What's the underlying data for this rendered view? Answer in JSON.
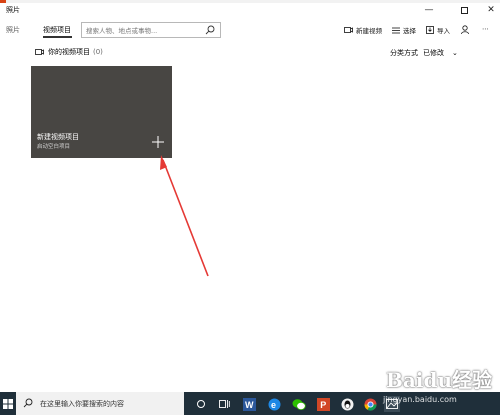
{
  "app": {
    "title": "照片"
  },
  "window_controls": {
    "minimize": "—",
    "close": "✕"
  },
  "nav": {
    "tabs": [
      {
        "label": "照片",
        "selected": false
      },
      {
        "label": "视频项目",
        "selected": true
      }
    ],
    "search_placeholder": "搜索人物、地点或事物..."
  },
  "commands": {
    "new_video": "新建视频",
    "select": "选择",
    "import": "导入",
    "more": "⋯"
  },
  "section": {
    "title": "你的视频项目",
    "count": "(0)",
    "sort_label": "分类方式",
    "sort_value": "已修改",
    "chevron": "⌄"
  },
  "new_project_tile": {
    "title": "新建视频项目",
    "subtitle": "启动空白项目",
    "color": "#484643"
  },
  "taskbar": {
    "search_text": "在这里输入你要搜索的内容",
    "icons": [
      "task-view-icon",
      "chat-icon",
      "word-icon",
      "edge-icon",
      "wechat-icon",
      "powerpoint-icon",
      "qq-icon",
      "chrome-icon",
      "photos-icon"
    ]
  },
  "watermark": {
    "brand": "Baidu经验",
    "url": "jingyan.baidu.com"
  },
  "accent": {
    "arrow": "#e53935",
    "taskbar": "#1f2f3a"
  }
}
